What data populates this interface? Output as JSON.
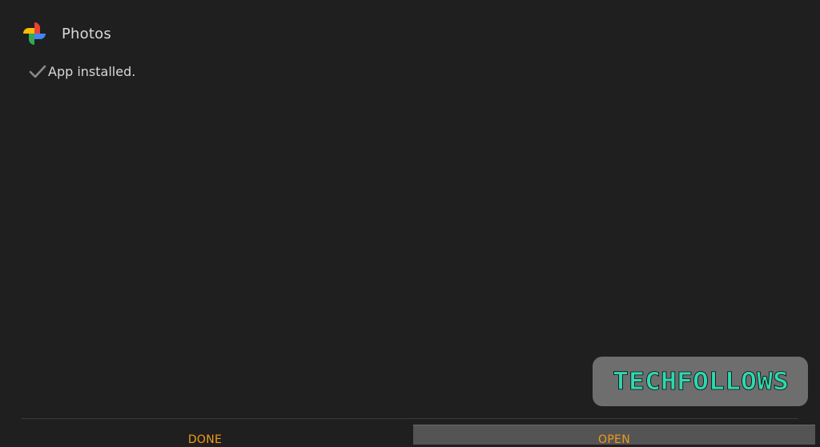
{
  "app": {
    "name": "Photos",
    "icon": "google-photos-pinwheel-icon"
  },
  "status": {
    "icon": "checkmark-icon",
    "text": "App installed."
  },
  "watermark": {
    "text": "TECHFOLLOWS",
    "color": "#2ed8b0"
  },
  "actions": {
    "done_label": "DONE",
    "open_label": "OPEN"
  },
  "colors": {
    "background": "#1f1f1f",
    "accent": "#f29a1a",
    "selected_button": "#545454"
  }
}
